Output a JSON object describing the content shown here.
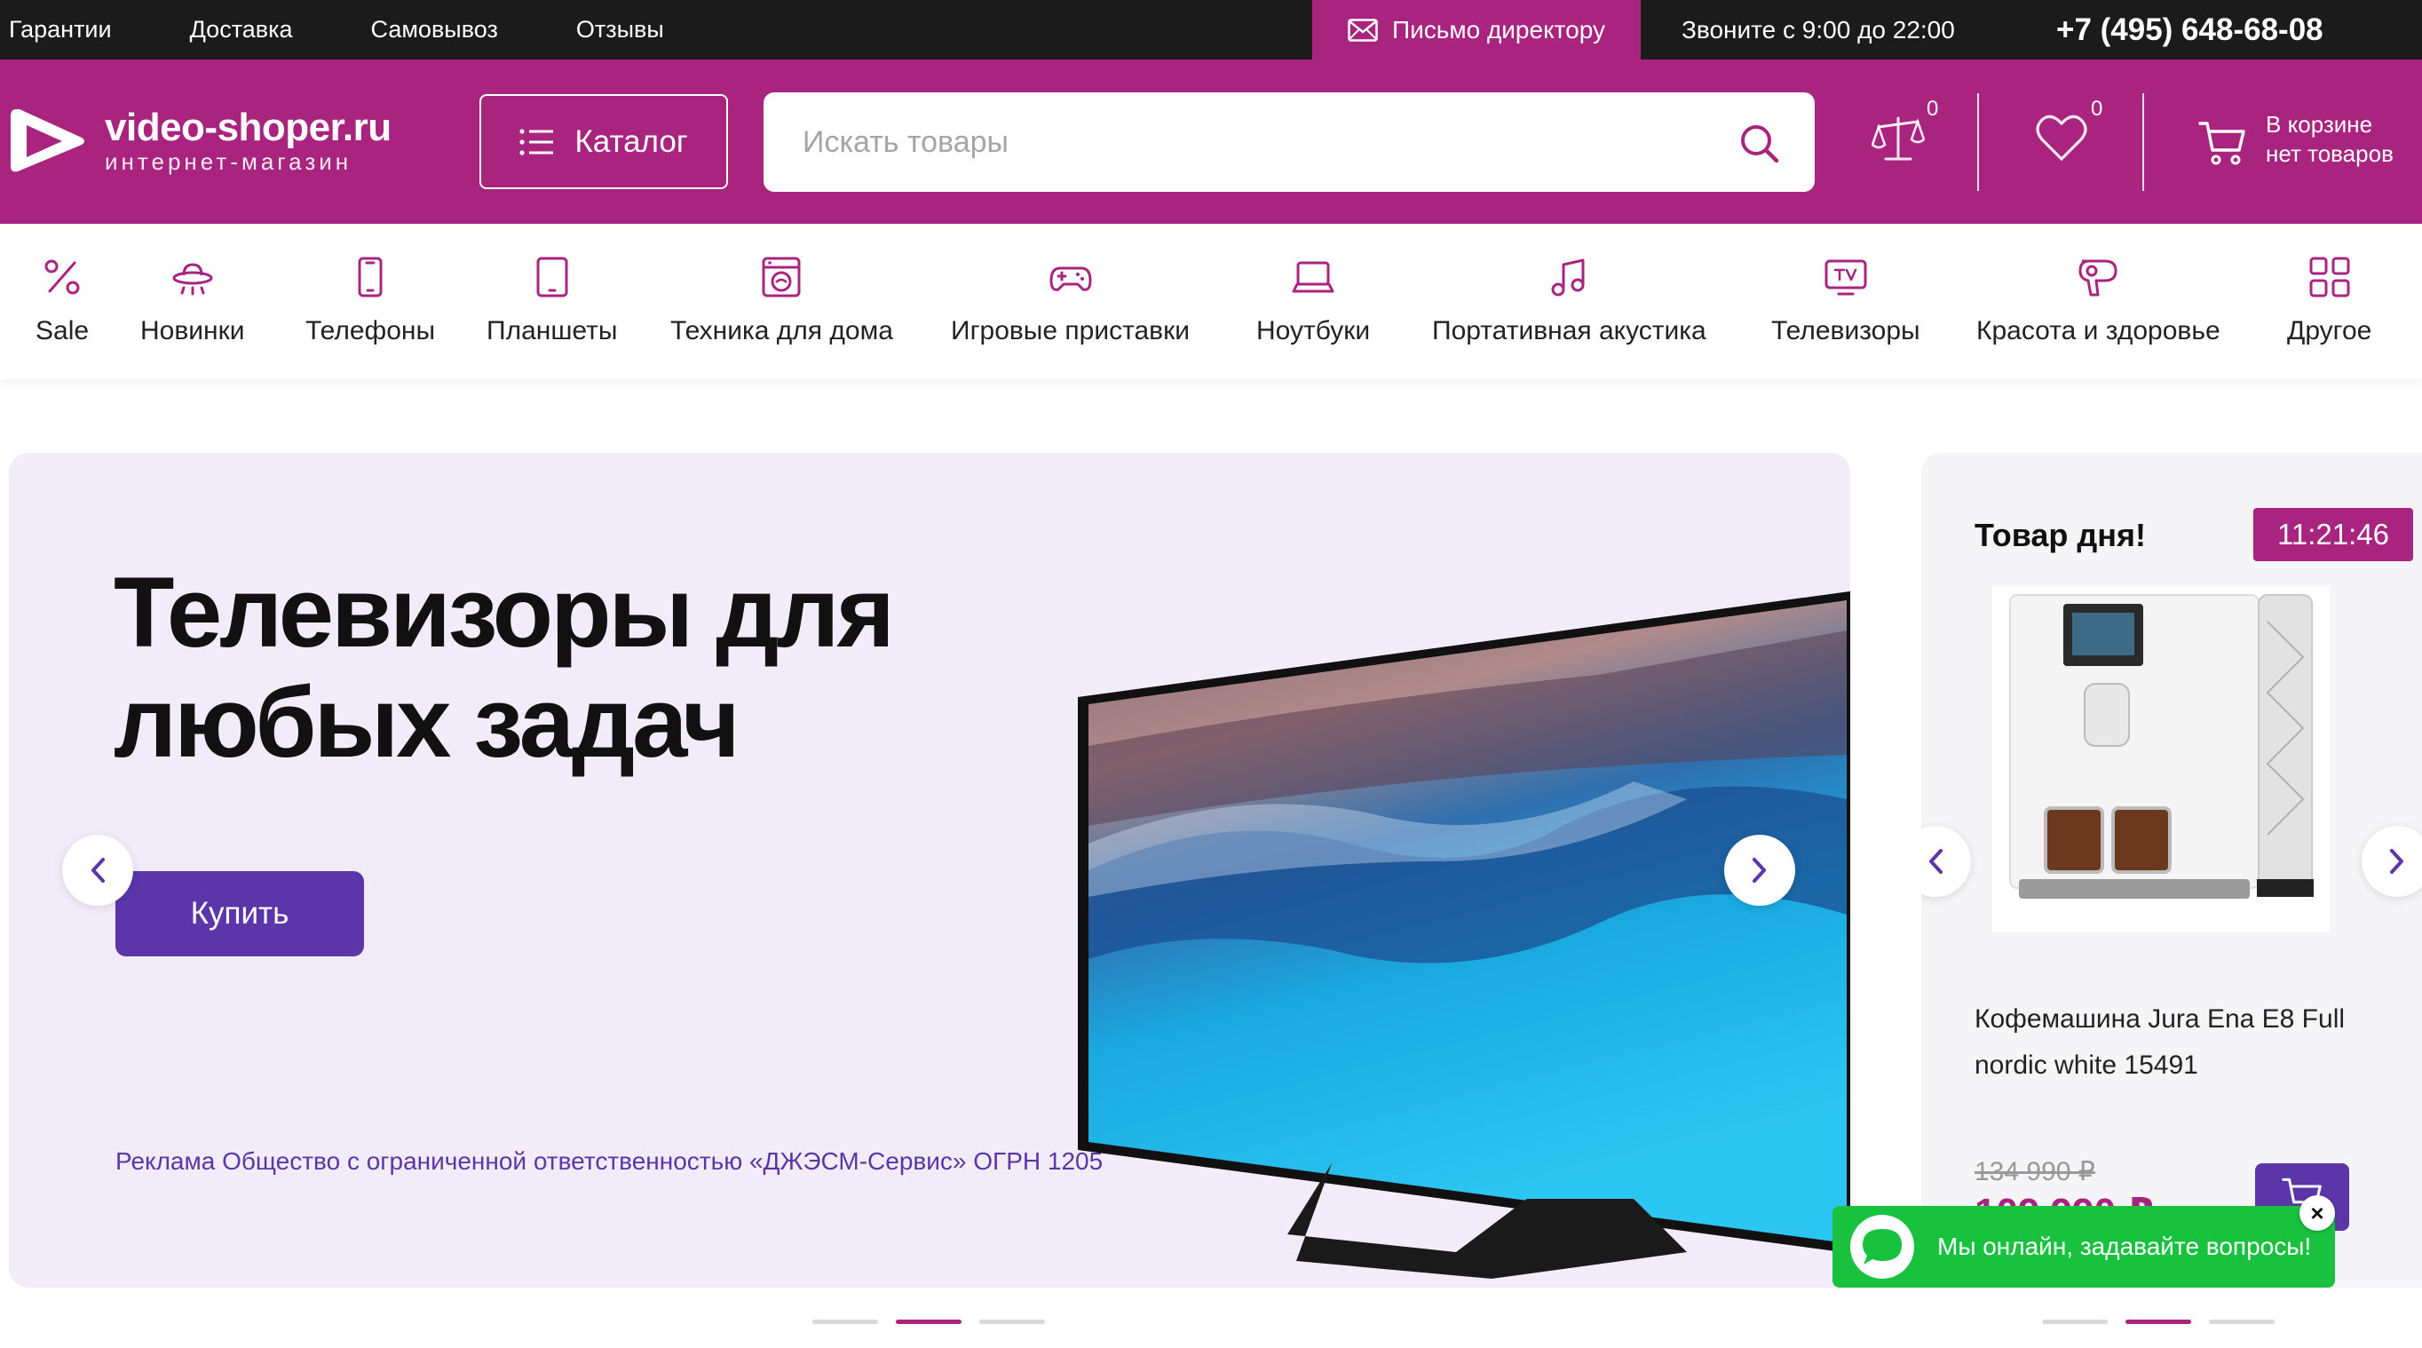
{
  "colors": {
    "brand": "#a8247e",
    "accent": "#5b36a8",
    "chat": "#18c23f",
    "topbar": "#1b1b1b"
  },
  "topbar": {
    "links": [
      "Гарантии",
      "Доставка",
      "Самовывоз",
      "Отзывы"
    ],
    "director_letter": "Письмо директору",
    "hours": "Звоните с 9:00 до 22:00",
    "phone": "+7 (495) 648-68-08"
  },
  "header": {
    "logo_name": "video-shoper.ru",
    "logo_sub": "интернет-магазин",
    "catalog_label": "Каталог",
    "search_placeholder": "Искать товары",
    "compare_count": "0",
    "favorites_count": "0",
    "cart_line1": "В корзине",
    "cart_line2": "нет товаров"
  },
  "categories": [
    {
      "label": "Sale",
      "icon": "percent-icon"
    },
    {
      "label": "Новинки",
      "icon": "ufo-icon"
    },
    {
      "label": "Телефоны",
      "icon": "phone-icon"
    },
    {
      "label": "Планшеты",
      "icon": "tablet-icon"
    },
    {
      "label": "Техника для дома",
      "icon": "washing-machine-icon"
    },
    {
      "label": "Игровые приставки",
      "icon": "gamepad-icon"
    },
    {
      "label": "Ноутбуки",
      "icon": "laptop-icon"
    },
    {
      "label": "Портативная акустика",
      "icon": "music-note-icon"
    },
    {
      "label": "Телевизоры",
      "icon": "tv-icon"
    },
    {
      "label": "Красота и здоровье",
      "icon": "hair-dryer-icon"
    },
    {
      "label": "Другое",
      "icon": "grid-icon"
    }
  ],
  "banner": {
    "title": "Телевизоры для любых задач",
    "button": "Купить",
    "ad_text": "Реклама Общество с ограниченной ответственностью «ДЖЭСМ-Сервис» ОГРН 1205"
  },
  "product_of_day": {
    "title": "Товар дня!",
    "timer": "11:21:46",
    "name": "Кофемашина Jura Ena E8 Full nordic white 15491",
    "old_price": "134 990 ₽",
    "price": "109 990 ₽"
  },
  "chat": {
    "message": "Мы онлайн, задавайте вопросы!",
    "close": "×"
  }
}
